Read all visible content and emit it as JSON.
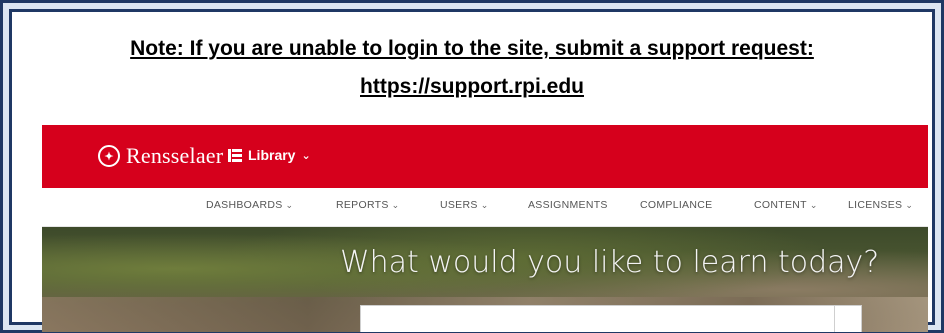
{
  "note": {
    "line1": "Note: If you are unable to login to the site, submit a support request:",
    "line2": "https://support.rpi.edu"
  },
  "header": {
    "brand": "Rensselaer",
    "library_label": "Library",
    "accent_color": "#d6001c"
  },
  "nav": {
    "items": [
      {
        "label": "DASHBOARDS",
        "has_dropdown": true
      },
      {
        "label": "REPORTS",
        "has_dropdown": true
      },
      {
        "label": "USERS",
        "has_dropdown": true
      },
      {
        "label": "ASSIGNMENTS",
        "has_dropdown": false
      },
      {
        "label": "COMPLIANCE",
        "has_dropdown": false
      },
      {
        "label": "CONTENT",
        "has_dropdown": true
      },
      {
        "label": "LICENSES",
        "has_dropdown": true
      }
    ]
  },
  "hero": {
    "title": "What would you like to learn today?"
  }
}
